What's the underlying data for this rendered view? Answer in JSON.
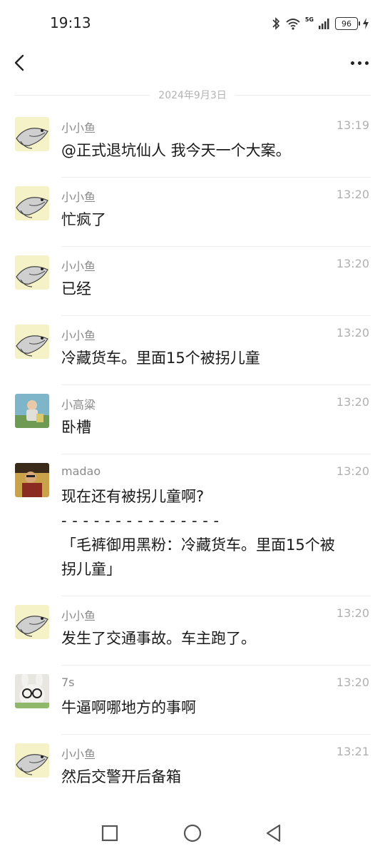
{
  "status_bar": {
    "time": "19:13",
    "network": "5G",
    "battery": "96"
  },
  "header": {
    "back_icon": "chevron-left-icon",
    "more_icon": "more-dots-icon"
  },
  "date_divider": "2024年9月3日",
  "messages": [
    {
      "avatar": "fish",
      "name": "小小鱼",
      "time": "13:19",
      "lines": [
        "@正式退坑仙人 我今天一个大案。"
      ]
    },
    {
      "avatar": "fish",
      "name": "小小鱼",
      "time": "13:20",
      "lines": [
        "忙疯了"
      ]
    },
    {
      "avatar": "fish",
      "name": "小小鱼",
      "time": "13:20",
      "lines": [
        "已经"
      ]
    },
    {
      "avatar": "fish",
      "name": "小小鱼",
      "time": "13:20",
      "lines": [
        "冷藏货车。里面15个被拐儿童"
      ]
    },
    {
      "avatar": "photo-kid",
      "name": "小高粱",
      "time": "13:20",
      "lines": [
        "卧槽"
      ]
    },
    {
      "avatar": "photo-madao",
      "name": "madao",
      "time": "13:20",
      "lines": [
        "现在还有被拐儿童啊?",
        "- - - - - - - - - - - - - - -",
        "「毛裤御用黑粉：冷藏货车。里面15个被",
        "拐儿童」"
      ]
    },
    {
      "avatar": "fish",
      "name": "小小鱼",
      "time": "13:20",
      "lines": [
        "发生了交通事故。车主跑了。"
      ]
    },
    {
      "avatar": "glasses-rabbit",
      "name": "7s",
      "time": "13:20",
      "lines": [
        "牛逼啊哪地方的事啊"
      ]
    },
    {
      "avatar": "fish",
      "name": "小小鱼",
      "time": "13:21",
      "lines": [
        "然后交警开后备箱"
      ]
    }
  ],
  "bottom_nav": {
    "square_icon": "recent-apps-icon",
    "circle_icon": "home-icon",
    "triangle_icon": "back-triangle-icon"
  }
}
